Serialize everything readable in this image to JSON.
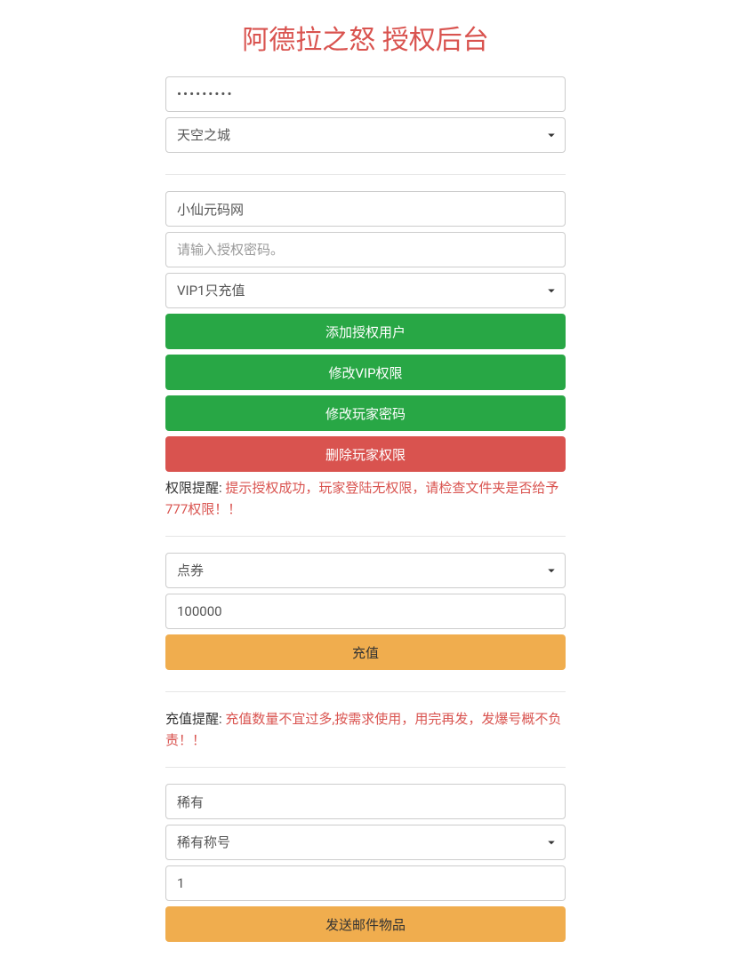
{
  "title": "阿德拉之怒 授权后台",
  "login": {
    "password_value": "•••••••••",
    "server_selected": "天空之城"
  },
  "auth_section": {
    "username_value": "小仙元码网",
    "auth_password_placeholder": "请输入授权密码。",
    "vip_selected": "VIP1只充值",
    "add_user_label": "添加授权用户",
    "modify_vip_label": "修改VIP权限",
    "modify_password_label": "修改玩家密码",
    "delete_permission_label": "删除玩家权限",
    "notice_label": "权限提醒: ",
    "notice_text": "提示授权成功，玩家登陆无权限，请检查文件夹是否给予777权限！！"
  },
  "recharge_section": {
    "currency_selected": "点券",
    "amount_value": "100000",
    "recharge_label": "充值",
    "notice_label": "充值提醒: ",
    "notice_text": "充值数量不宜过多,按需求使用，用完再发，发爆号概不负责！！"
  },
  "mail_section": {
    "rarity_value": "稀有",
    "title_selected": "稀有称号",
    "quantity_value": "1",
    "send_label": "发送邮件物品"
  }
}
